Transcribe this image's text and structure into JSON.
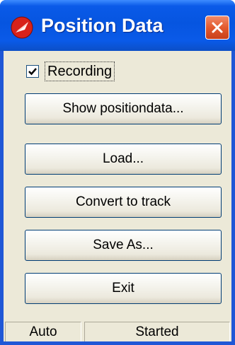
{
  "window": {
    "title": "Position Data",
    "accent_color": "#0655e0",
    "close_color": "#e35a2e",
    "icons": {
      "app": "red-logo-icon",
      "close": "close-icon"
    }
  },
  "recording": {
    "label": "Recording",
    "checked": true
  },
  "buttons": {
    "show": "Show positiondata...",
    "load": "Load...",
    "convert": "Convert to track",
    "save_as": "Save As...",
    "exit": "Exit"
  },
  "status": {
    "mode": "Auto",
    "state": "Started"
  }
}
